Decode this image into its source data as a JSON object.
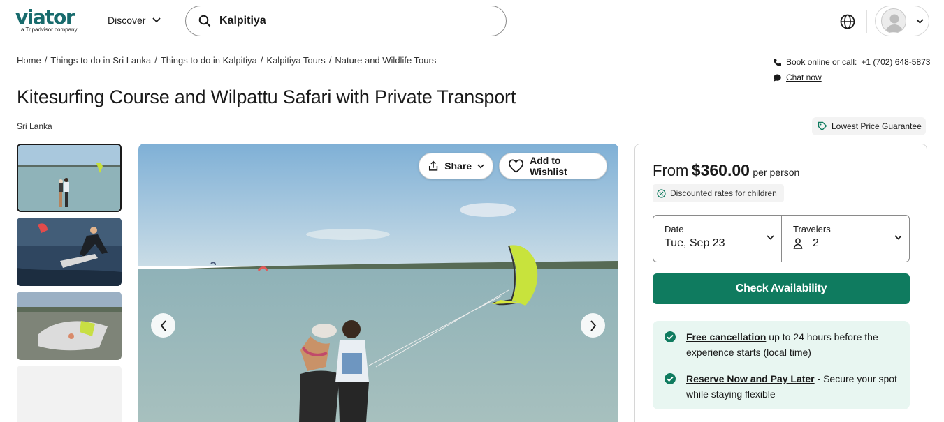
{
  "header": {
    "logo_text": "viator",
    "logo_subtitle": "a Tripadvisor company",
    "discover_label": "Discover",
    "search_value": "Kalpitiya"
  },
  "breadcrumb": [
    "Home",
    "Things to do in Sri Lanka",
    "Things to do in Kalpitiya",
    "Kalpitiya Tours",
    "Nature and Wildlife Tours"
  ],
  "breadcrumb_separator": "/",
  "contact": {
    "book_label": "Book online or call:",
    "phone": "+1 (702) 648-5873",
    "chat_label": "Chat now"
  },
  "product": {
    "title": "Kitesurfing Course and Wilpattu Safari with Private Transport",
    "location": "Sri Lanka",
    "lowest_price_label": "Lowest Price Guarantee"
  },
  "gallery": {
    "share_label": "Share",
    "wishlist_label": "Add to Wishlist",
    "thumbnail_count": 3,
    "active_thumbnail": 0
  },
  "booking": {
    "from_label": "From",
    "price": "$360.00",
    "per_label": "per person",
    "discount_label": "Discounted rates for children",
    "date_label": "Date",
    "date_value": "Tue, Sep 23",
    "travelers_label": "Travelers",
    "travelers_value": "2",
    "check_label": "Check Availability",
    "benefits": [
      {
        "title": "Free cancellation",
        "text": " up to 24 hours before the experience starts (local time)"
      },
      {
        "title": "Reserve Now and Pay Later",
        "text": " - Secure your spot while staying flexible"
      }
    ]
  },
  "colors": {
    "brand": "#186b6d",
    "primary_button": "#0f7b5f",
    "benefit_bg": "#e8f6f1"
  }
}
